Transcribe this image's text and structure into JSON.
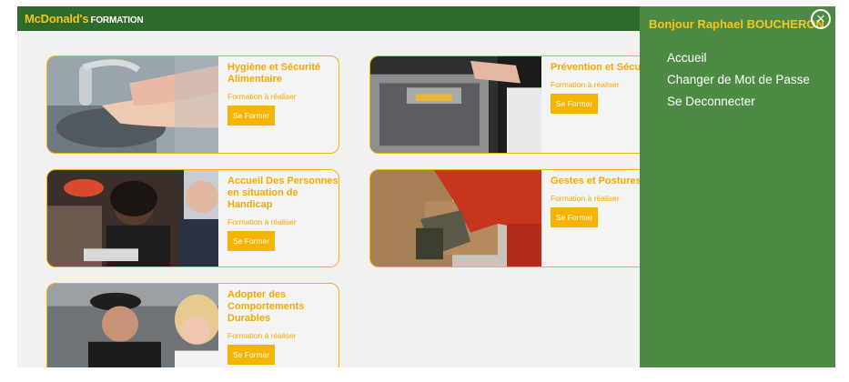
{
  "header": {
    "brand": "McDonald's",
    "brand_suffix": "FORMATION",
    "brand_color": "#f5c518",
    "bar_color": "#2e6b2b"
  },
  "courses": [
    {
      "title": "Hygiène et Sécurité Alimentaire",
      "status": "Formation à réaliser",
      "button": "Se Former"
    },
    {
      "title": "Prévention et Sécurité",
      "status": "Formation à réaliser",
      "button": "Se Former"
    },
    {
      "title": "Accueil Des Personnes en situation de Handicap",
      "status": "Formation à réaliser",
      "button": "Se Former"
    },
    {
      "title": "Gestes et Postures",
      "status": "Formation à réaliser",
      "button": "Se Former"
    },
    {
      "title": "Adopter des Comportements Durables",
      "status": "Formation à réaliser",
      "button": "Se Former"
    }
  ],
  "drawer": {
    "greeting": "Bonjour Raphael BOUCHERON",
    "close_icon": "close-icon",
    "menu": [
      "Accueil",
      "Changer de Mot de Passe",
      "Se Deconnecter"
    ],
    "background": "#4d8b45"
  },
  "accent_color": "#f5b400"
}
